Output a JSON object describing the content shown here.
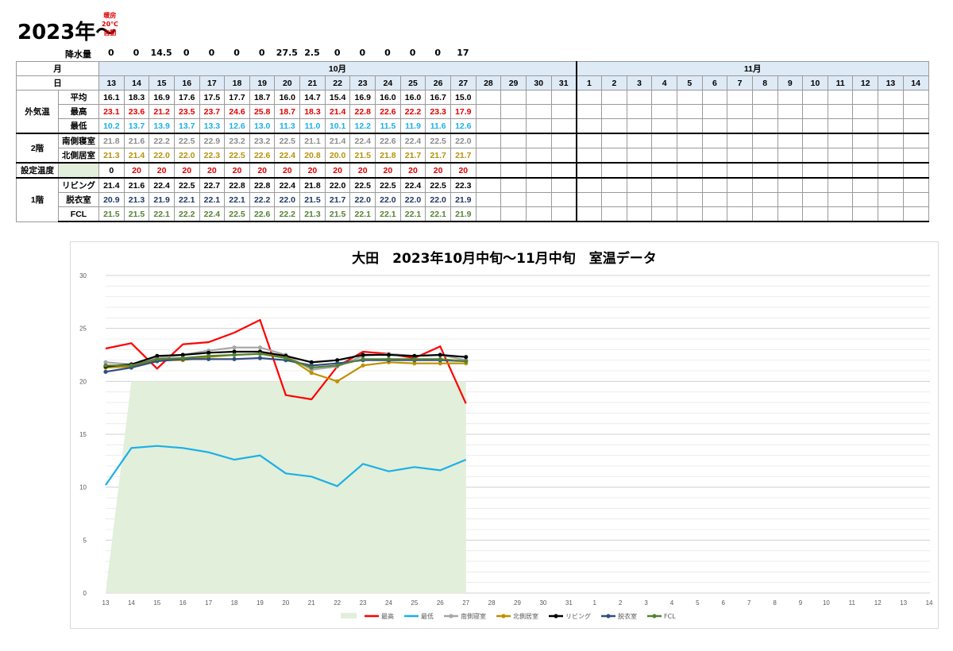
{
  "page": {
    "title": "2023年～",
    "note": [
      "暖房",
      "20℃",
      "自動"
    ]
  },
  "rain": {
    "label": "降水量",
    "values": [
      "0",
      "0",
      "14.5",
      "0",
      "0",
      "0",
      "0",
      "27.5",
      "2.5",
      "0",
      "0",
      "0",
      "0",
      "0",
      "17"
    ]
  },
  "table": {
    "month_label": "月",
    "day_label": "日",
    "oct": "10月",
    "nov": "11月",
    "days": [
      "13",
      "14",
      "15",
      "16",
      "17",
      "18",
      "19",
      "20",
      "21",
      "22",
      "23",
      "24",
      "25",
      "26",
      "27",
      "28",
      "29",
      "30",
      "31",
      "1",
      "2",
      "3",
      "4",
      "5",
      "6",
      "7",
      "8",
      "9",
      "10",
      "11",
      "12",
      "13",
      "14"
    ],
    "groups": {
      "outside": "外気温",
      "floor2": "2階",
      "setting": "設定温度",
      "floor1": "1階"
    },
    "rows": [
      {
        "label": "平均",
        "color": "#000000",
        "values": [
          "16.1",
          "18.3",
          "16.9",
          "17.6",
          "17.5",
          "17.7",
          "18.7",
          "16.0",
          "14.7",
          "15.4",
          "16.9",
          "16.0",
          "16.0",
          "16.7",
          "15.0"
        ]
      },
      {
        "label": "最高",
        "color": "#e00000",
        "values": [
          "23.1",
          "23.6",
          "21.2",
          "23.5",
          "23.7",
          "24.6",
          "25.8",
          "18.7",
          "18.3",
          "21.4",
          "22.8",
          "22.6",
          "22.2",
          "23.3",
          "17.9"
        ]
      },
      {
        "label": "最低",
        "color": "#1ab0e8",
        "values": [
          "10.2",
          "13.7",
          "13.9",
          "13.7",
          "13.3",
          "12.6",
          "13.0",
          "11.3",
          "11.0",
          "10.1",
          "12.2",
          "11.5",
          "11.9",
          "11.6",
          "12.6"
        ]
      },
      {
        "label": "南側寝室",
        "color": "#8c8c8c",
        "values": [
          "21.8",
          "21.6",
          "22.2",
          "22.5",
          "22.9",
          "23.2",
          "23.2",
          "22.5",
          "21.1",
          "21.4",
          "22.4",
          "22.6",
          "22.4",
          "22.5",
          "22.0"
        ]
      },
      {
        "label": "北側居室",
        "color": "#b8910c",
        "values": [
          "21.3",
          "21.4",
          "22.0",
          "22.0",
          "22.3",
          "22.5",
          "22.6",
          "22.4",
          "20.8",
          "20.0",
          "21.5",
          "21.8",
          "21.7",
          "21.7",
          "21.7"
        ]
      },
      {
        "label": "",
        "color": "#e00000",
        "values": [
          "0",
          "20",
          "20",
          "20",
          "20",
          "20",
          "20",
          "20",
          "20",
          "20",
          "20",
          "20",
          "20",
          "20",
          "20"
        ]
      },
      {
        "label": "リビング",
        "color": "#000000",
        "values": [
          "21.4",
          "21.6",
          "22.4",
          "22.5",
          "22.7",
          "22.8",
          "22.8",
          "22.4",
          "21.8",
          "22.0",
          "22.5",
          "22.5",
          "22.4",
          "22.5",
          "22.3"
        ]
      },
      {
        "label": "脱衣室",
        "color": "#1f3864",
        "values": [
          "20.9",
          "21.3",
          "21.9",
          "22.1",
          "22.1",
          "22.1",
          "22.2",
          "22.0",
          "21.5",
          "21.7",
          "22.0",
          "22.0",
          "22.0",
          "22.0",
          "21.9"
        ]
      },
      {
        "label": "FCL",
        "color": "#548235",
        "values": [
          "21.5",
          "21.5",
          "22.1",
          "22.2",
          "22.4",
          "22.5",
          "22.6",
          "22.2",
          "21.3",
          "21.5",
          "22.1",
          "22.1",
          "22.1",
          "22.1",
          "21.9"
        ]
      }
    ]
  },
  "chart_data": {
    "type": "line",
    "title": "大田　2023年10月中旬～11月中旬　室温データ",
    "xlabel": "",
    "ylabel": "",
    "ylim": [
      0,
      30
    ],
    "yticks": [
      "0",
      "5",
      "10",
      "15",
      "20",
      "25",
      "30"
    ],
    "grid": true,
    "legend_position": "bottom",
    "categories": [
      "13",
      "14",
      "15",
      "16",
      "17",
      "18",
      "19",
      "20",
      "21",
      "22",
      "23",
      "24",
      "25",
      "26",
      "27",
      "28",
      "29",
      "30",
      "31",
      "1",
      "2",
      "3",
      "4",
      "5",
      "6",
      "7",
      "8",
      "9",
      "10",
      "11",
      "12",
      "13",
      "14"
    ],
    "area": {
      "name": "",
      "color": "#e2efda",
      "values": [
        0,
        20,
        20,
        20,
        20,
        20,
        20,
        20,
        20,
        20,
        20,
        20,
        20,
        20,
        20
      ]
    },
    "series": [
      {
        "name": "最高",
        "color": "#ff0000",
        "marker": false,
        "values": [
          23.1,
          23.6,
          21.2,
          23.5,
          23.7,
          24.6,
          25.8,
          18.7,
          18.3,
          21.4,
          22.8,
          22.6,
          22.2,
          23.3,
          17.9
        ]
      },
      {
        "name": "最低",
        "color": "#1ab0e8",
        "marker": false,
        "values": [
          10.2,
          13.7,
          13.9,
          13.7,
          13.3,
          12.6,
          13.0,
          11.3,
          11.0,
          10.1,
          12.2,
          11.5,
          11.9,
          11.6,
          12.6
        ]
      },
      {
        "name": "南側寝室",
        "color": "#a6a6a6",
        "marker": true,
        "values": [
          21.8,
          21.6,
          22.2,
          22.5,
          22.9,
          23.2,
          23.2,
          22.5,
          21.1,
          21.4,
          22.4,
          22.6,
          22.4,
          22.5,
          22.0
        ]
      },
      {
        "name": "北側居室",
        "color": "#bf9000",
        "marker": true,
        "values": [
          21.3,
          21.4,
          22.0,
          22.0,
          22.3,
          22.5,
          22.6,
          22.4,
          20.8,
          20.0,
          21.5,
          21.8,
          21.7,
          21.7,
          21.7
        ]
      },
      {
        "name": "リビング",
        "color": "#000000",
        "marker": true,
        "values": [
          21.4,
          21.6,
          22.4,
          22.5,
          22.7,
          22.8,
          22.8,
          22.4,
          21.8,
          22.0,
          22.5,
          22.5,
          22.4,
          22.5,
          22.3
        ]
      },
      {
        "name": "脱衣室",
        "color": "#2f4f7f",
        "marker": true,
        "values": [
          20.9,
          21.3,
          21.9,
          22.1,
          22.1,
          22.1,
          22.2,
          22.0,
          21.5,
          21.7,
          22.0,
          22.0,
          22.0,
          22.0,
          21.9
        ]
      },
      {
        "name": "FCL",
        "color": "#548235",
        "marker": true,
        "values": [
          21.5,
          21.5,
          22.1,
          22.2,
          22.4,
          22.5,
          22.6,
          22.2,
          21.3,
          21.5,
          22.1,
          22.1,
          22.1,
          22.1,
          21.9
        ]
      }
    ]
  }
}
